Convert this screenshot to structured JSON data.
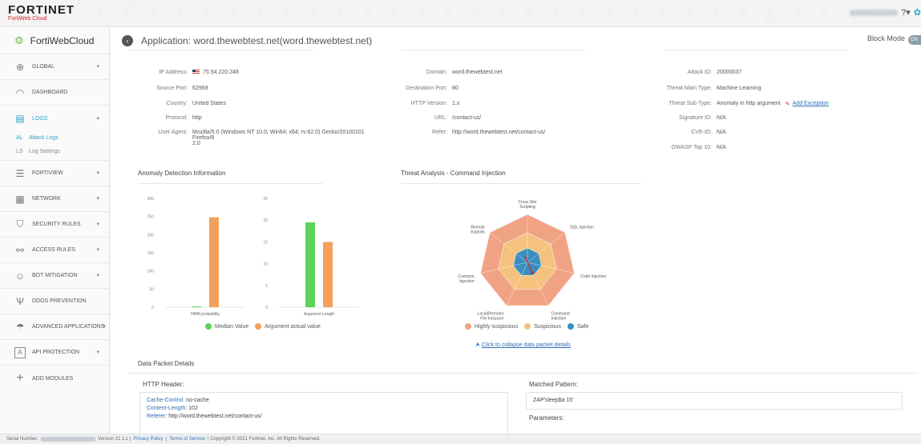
{
  "brand": {
    "name": "FORTINET",
    "product": "FortiWeb Cloud"
  },
  "sidebar": {
    "product_label": "FortiWebCloud",
    "items": [
      {
        "label": "GLOBAL",
        "icon": "globe-icon"
      },
      {
        "label": "DASHBOARD",
        "icon": "dashboard-icon"
      },
      {
        "label": "LOGS",
        "icon": "logs-icon"
      },
      {
        "label": "FORTIVIEW",
        "icon": "fortiview-icon"
      },
      {
        "label": "NETWORK",
        "icon": "network-icon"
      },
      {
        "label": "SECURITY RULES",
        "icon": "shield-icon"
      },
      {
        "label": "ACCESS RULES",
        "icon": "access-icon"
      },
      {
        "label": "BOT MITIGATION",
        "icon": "bot-icon"
      },
      {
        "label": "DDOS PREVENTION",
        "icon": "ddos-icon"
      },
      {
        "label": "ADVANCED APPLICATIONS",
        "icon": "umbrella-icon"
      },
      {
        "label": "API PROTECTION",
        "icon": "api-icon"
      },
      {
        "label": "ADD MODULES",
        "icon": "plus-icon"
      }
    ],
    "logs_sub": [
      {
        "abbr": "AL",
        "label": "Attack Logs"
      },
      {
        "abbr": "LS",
        "label": "Log Settings"
      }
    ]
  },
  "header": {
    "app_title": "Application: word.thewebtest.net(word.thewebtest.net)",
    "block_mode_label": "Block Mode",
    "toggle_label": "ON"
  },
  "client": {
    "ip_label": "IP Address:",
    "ip_value": "75.54.220.248",
    "port_label": "Source Port:",
    "port_value": "62969",
    "country_label": "Country:",
    "country_value": "United States",
    "protocol_label": "Protocol:",
    "protocol_value": "http",
    "ua_label": "User Agent:",
    "ua_value_1": "Mozilla/5.0 (Windows NT 10.0; Win64; x64; rv:82.0) Gecko/20100101 Firefox/8",
    "ua_value_2": "2.0"
  },
  "server": {
    "domain_label": "Domain:",
    "domain_value": "word.thewebtest.net",
    "dport_label": "Destination Port:",
    "dport_value": "80",
    "http_label": "HTTP Version:",
    "http_value": "1.x",
    "url_label": "URL:",
    "url_value": "/contact-us/",
    "refer_label": "Refer:",
    "refer_value": "http://word.thewebtest.net/contact-us/"
  },
  "threat": {
    "attack_id_label": "Attack ID:",
    "attack_id_value": "20000037",
    "main_type_label": "Threat Main Type:",
    "main_type_value": "Machine Learning",
    "sub_type_label": "Threat Sub Type:",
    "sub_type_value": "Anomaly in http argument",
    "add_exception": "Add Exception",
    "sig_label": "Signature ID:",
    "sig_value": "N/A",
    "cve_label": "CVE-ID:",
    "cve_value": "N/A",
    "owasp_label": "OWASP Top 10:",
    "owasp_value": "N/A"
  },
  "anomaly": {
    "title": "Anomaly Detection Information",
    "legend_median": "Median Value",
    "legend_actual": "Argument actual value",
    "color_median": "#5bd35b",
    "color_actual": "#f5a05a"
  },
  "threat_analysis": {
    "title": "Threat Analysis - Command Injection",
    "legend": [
      "Highly suspicious",
      "Suspicious",
      "Safe"
    ],
    "colors": [
      "#f0a384",
      "#f4c27d",
      "#3a8fbf"
    ],
    "collapse_link": "Click to collapse data packet details"
  },
  "chart_data": [
    {
      "type": "bar",
      "categories": [
        "HMM probability"
      ],
      "series": [
        {
          "name": "Median Value",
          "values": [
            2
          ]
        },
        {
          "name": "Argument actual value",
          "values": [
            248
          ]
        }
      ],
      "ylim": [
        0,
        300
      ],
      "yticks": [
        "300",
        "250",
        "200",
        "150",
        "100",
        "50",
        "0"
      ]
    },
    {
      "type": "bar",
      "categories": [
        "Argument Length"
      ],
      "series": [
        {
          "name": "Median Value",
          "values": [
            19.5
          ]
        },
        {
          "name": "Argument actual value",
          "values": [
            15
          ]
        }
      ],
      "ylim": [
        0,
        25
      ],
      "yticks": [
        "25",
        "20",
        "15",
        "10",
        "5",
        "0"
      ]
    },
    {
      "type": "radar",
      "axes": [
        "Cross Site Scripting",
        "SQL Injection",
        "Code Injection",
        "Command Injection",
        "Local(Remote) File Inclusion",
        "Common Injection",
        "Remote Exploits"
      ],
      "axis_label_lines": [
        [
          "Cross Site",
          "Scripting"
        ],
        [
          "SQL Injection"
        ],
        [
          "Code Injection"
        ],
        [
          "Command",
          "Injection"
        ],
        [
          "Local(Remote)",
          "File Inclusion"
        ],
        [
          "Common",
          "Injection"
        ],
        [
          "Remote",
          "Exploits"
        ]
      ],
      "bands": [
        "Highly suspicious",
        "Suspicious",
        "Safe"
      ]
    }
  ],
  "packet": {
    "title": "Data Packet Details",
    "http_header_title": "HTTP Header:",
    "header_lines": [
      {
        "key": "Cache-Control:",
        "value": "no-cache"
      },
      {
        "key": "Content-Length:",
        "value": "102"
      },
      {
        "key": "Referer:",
        "value": "http://word.thewebtest.net/contact-us/"
      }
    ],
    "matched_title": "Matched Pattern:",
    "matched_value": "ZAP'sleep$a 15'",
    "params_title": "Parameters:"
  },
  "footer": {
    "serial_label": "Serial Number:",
    "version": "Version 21.1.c |",
    "privacy": "Privacy Policy",
    "sep": "|",
    "terms": "Terms of Service",
    "copyright": "| Copyright © 2021 Fortinet, Inc. All Rights Reserved."
  }
}
